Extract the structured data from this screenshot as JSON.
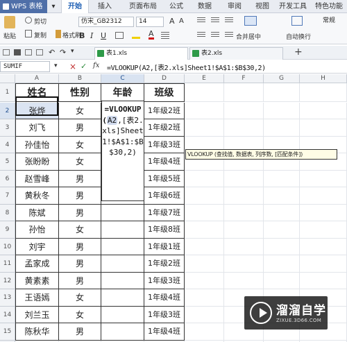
{
  "app": {
    "logo": "WPS 表格"
  },
  "ribbon_tabs": [
    "开始",
    "插入",
    "页面布局",
    "公式",
    "数据",
    "审阅",
    "视图",
    "开发工具",
    "特色功能"
  ],
  "ribbon": {
    "paste": "粘贴",
    "cut": "剪切",
    "copy": "复制",
    "format_painter": "格式刷",
    "font_name": "仿宋_GB2312",
    "font_size": "14",
    "merge_center": "合并居中",
    "wrap": "自动换行",
    "number_format": "常规"
  },
  "doc_tabs": [
    "表1.xls",
    "表2.xls"
  ],
  "formula_bar": {
    "name_box": "SUMIF",
    "fx": "fx",
    "formula": "=VLOOKUP(A2,[表2.xls]Sheet1!$A$1:$B$30,2)"
  },
  "columns": [
    "A",
    "B",
    "C",
    "D",
    "E",
    "F",
    "G",
    "H"
  ],
  "rows": [
    "1",
    "2",
    "3",
    "4",
    "5",
    "6",
    "7",
    "8",
    "9",
    "10",
    "11",
    "12",
    "13",
    "14",
    "15",
    "16"
  ],
  "table": {
    "headers": [
      "姓名",
      "性别",
      "年龄",
      "班级"
    ],
    "names": [
      "张烨",
      "刘飞",
      "孙佳怡",
      "张盼盼",
      "赵雪峰",
      "黄秋冬",
      "陈斌",
      "孙怡",
      "刘宇",
      "孟家成",
      "黄素素",
      "王语嫣",
      "刘兰玉",
      "陈秋华"
    ],
    "genders": [
      "女",
      "男",
      "女",
      "女",
      "男",
      "男",
      "男",
      "女",
      "男",
      "男",
      "男",
      "女",
      "女",
      "男"
    ],
    "classes": [
      "1年级2班",
      "1年级2班",
      "1年级3班",
      "1年级4班",
      "1年级5班",
      "1年级6班",
      "1年级7班",
      "1年级8班",
      "1年级1班",
      "1年级2班",
      "1年级3班",
      "1年级4班",
      "1年级3班",
      "1年级4班"
    ]
  },
  "cell_editor": "=VLOOKUP(A2,[表2.xls]Sheet1!$A$1:$B$30,2)",
  "tooltip": "VLOOKUP (查找值, 数据表, 列序数, [匹配条件])",
  "watermark": {
    "title": "溜溜自学",
    "url": "ZIXUE.3D66.COM"
  }
}
